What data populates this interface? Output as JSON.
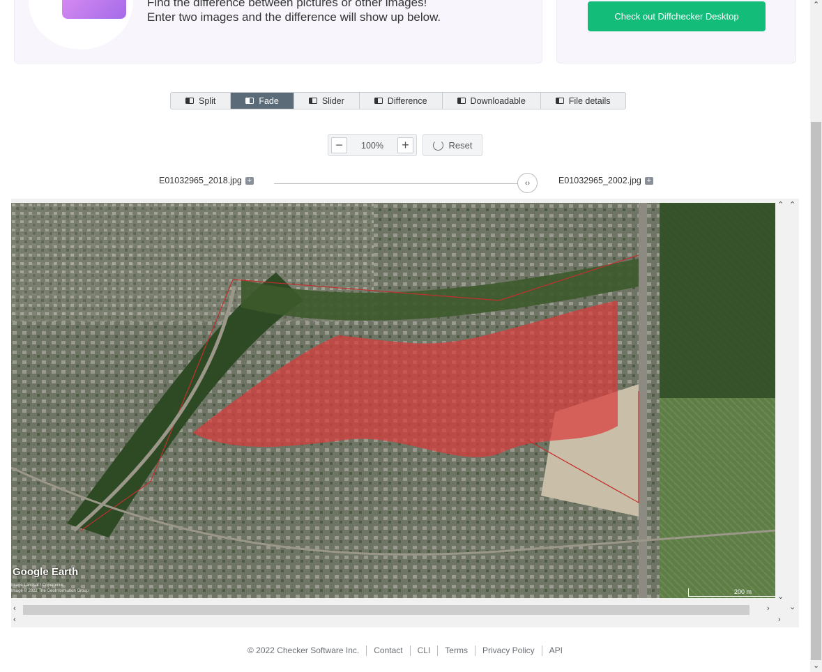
{
  "intro": {
    "line1": "Find the difference between pictures or other images!",
    "line2": "Enter two images and the difference will show up below."
  },
  "cta": {
    "label": "Check out Diffchecker Desktop"
  },
  "tabs": [
    {
      "label": "Split",
      "active": false
    },
    {
      "label": "Fade",
      "active": true
    },
    {
      "label": "Slider",
      "active": false
    },
    {
      "label": "Difference",
      "active": false
    },
    {
      "label": "Downloadable",
      "active": false
    },
    {
      "label": "File details",
      "active": false
    }
  ],
  "zoom": {
    "value": "100%",
    "minus": "−",
    "plus": "+",
    "reset_label": "Reset"
  },
  "files": {
    "left": "E01032965_2018.jpg",
    "right": "E01032965_2002.jpg",
    "fade_handle": "‹›"
  },
  "image_overlay": {
    "logo": "Google Earth",
    "credit_line1": "Image Landsat / Copernicus",
    "credit_line2": "Image © 2022 The GeoInformation Group",
    "scale": "200 m"
  },
  "footer": {
    "copyright": "© 2022 Checker Software Inc.",
    "links": [
      "Contact",
      "CLI",
      "Terms",
      "Privacy Policy",
      "API"
    ]
  },
  "colors": {
    "accent": "#14bc7a",
    "tab_active": "#5b6b78",
    "highlight": "#d93c3c"
  }
}
